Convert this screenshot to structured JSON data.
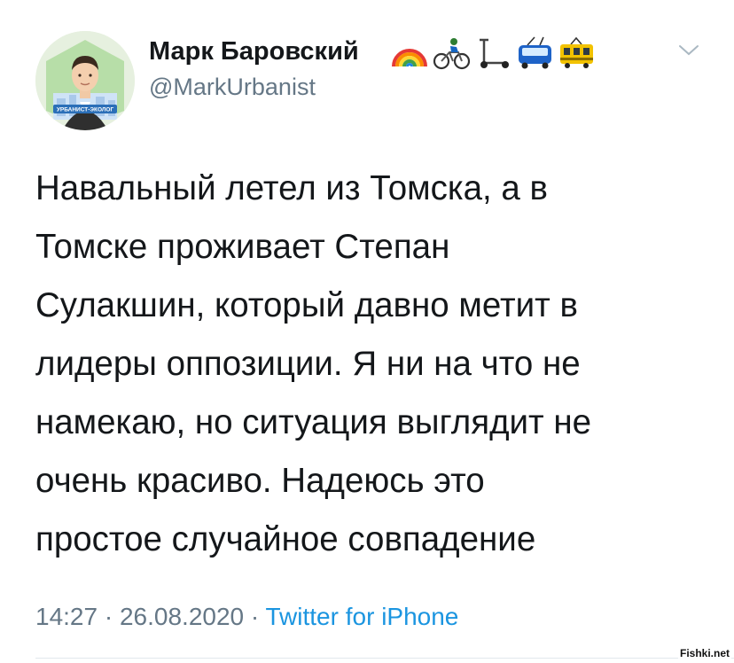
{
  "tweet": {
    "author_name": "Марк Баровский",
    "author_handle": "@MarkUrbanist",
    "name_emojis": [
      "rainbow-icon",
      "cyclist-icon",
      "scooter-icon",
      "trolleybus-icon",
      "tram-icon"
    ],
    "avatar_badge": "УРБАНИСТ-ЭКОЛОГ",
    "text": "Навальный летел из Томска, а в\nТомске проживает Степан\nСулакшин, который давно метит в\nлидеры оппозиции. Я ни на что не\nнамекаю, но ситуация выглядит не\nочень красиво. Надеюсь это\nпростое случайное совпадение",
    "time": "14:27",
    "separator": "·",
    "date": "26.08.2020",
    "source": "Twitter for iPhone"
  },
  "watermark": "Fishki.net",
  "colors": {
    "text": "#14171a",
    "secondary": "#657786",
    "link": "#1b95e0",
    "divider": "#e1e8ed"
  }
}
